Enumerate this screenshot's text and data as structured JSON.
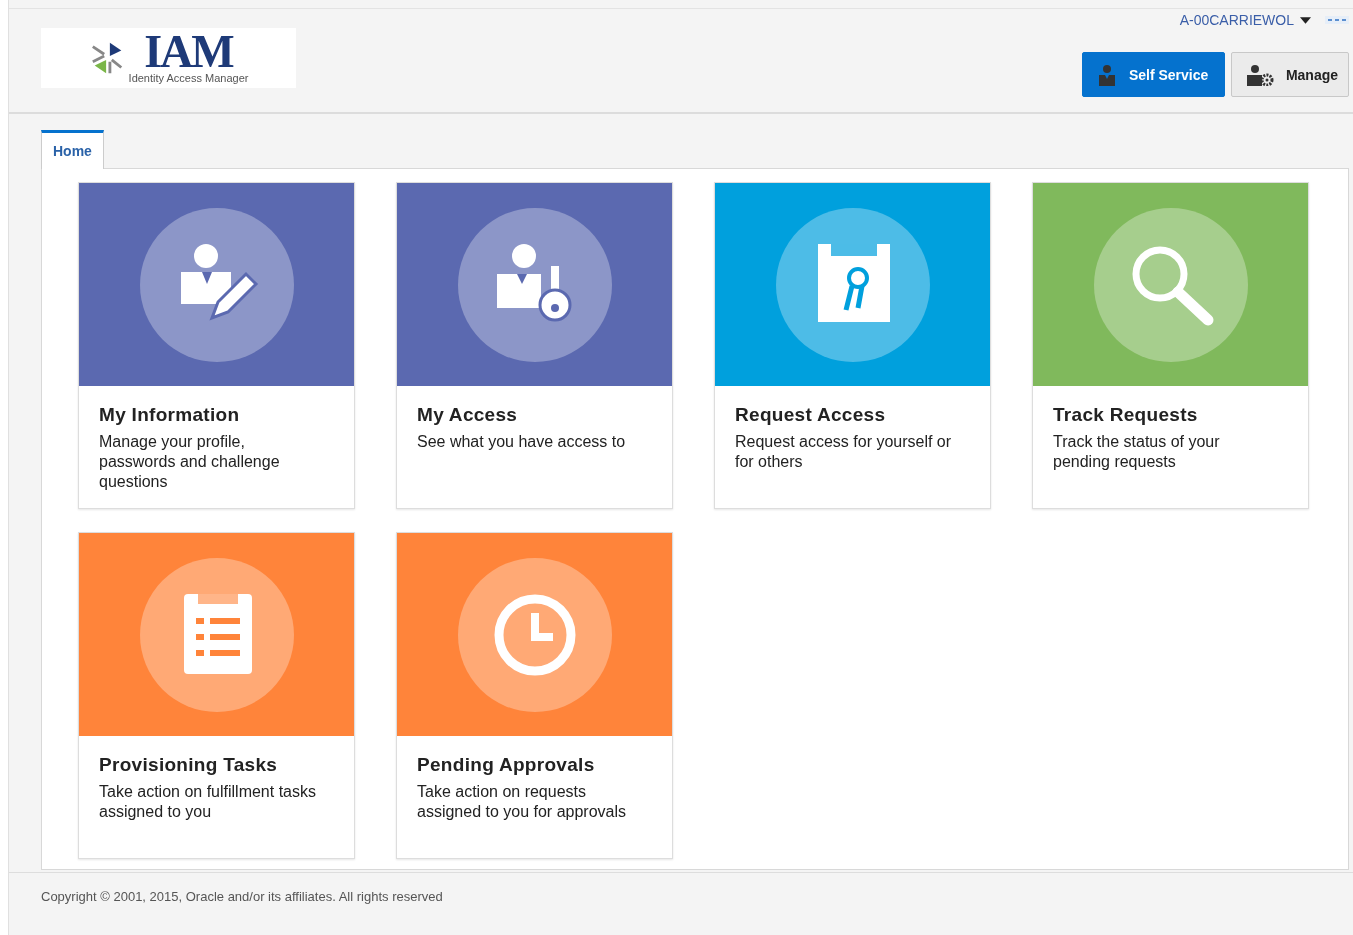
{
  "logo": {
    "title": "IAM",
    "subtitle": "Identity Access Manager"
  },
  "user_menu": {
    "label": "A-00CARRIEWOL"
  },
  "mode_buttons": [
    {
      "label": "Self Service",
      "kind": "person",
      "selected": true
    },
    {
      "label": "Manage",
      "kind": "manage",
      "selected": false
    }
  ],
  "tabs": [
    {
      "label": "Home",
      "selected": true
    }
  ],
  "tiles": [
    {
      "title": "My Information",
      "description": "Manage your profile, passwords and challenge questions",
      "kind": "edit-person",
      "color": "#5b69b0"
    },
    {
      "title": "My Access",
      "description": "See what you have access to",
      "kind": "person-key",
      "color": "#5b69b0"
    },
    {
      "title": "Request Access",
      "description": "Request access for yourself or for others",
      "kind": "clipboard-key",
      "color": "#00a0dd"
    },
    {
      "title": "Track Requests",
      "description": "Track the status of your pending requests",
      "kind": "search",
      "color": "#80b95c"
    },
    {
      "title": "Provisioning Tasks",
      "description": "Take action on fulfillment tasks assigned to you",
      "kind": "list",
      "color": "#ff843a"
    },
    {
      "title": "Pending Approvals",
      "description": "Take action on requests assigned to you for approvals",
      "kind": "clock",
      "color": "#ff843a"
    }
  ],
  "footer": {
    "copyright": "Copyright © 2001, 2015, Oracle and/or its affiliates. All rights reserved"
  }
}
